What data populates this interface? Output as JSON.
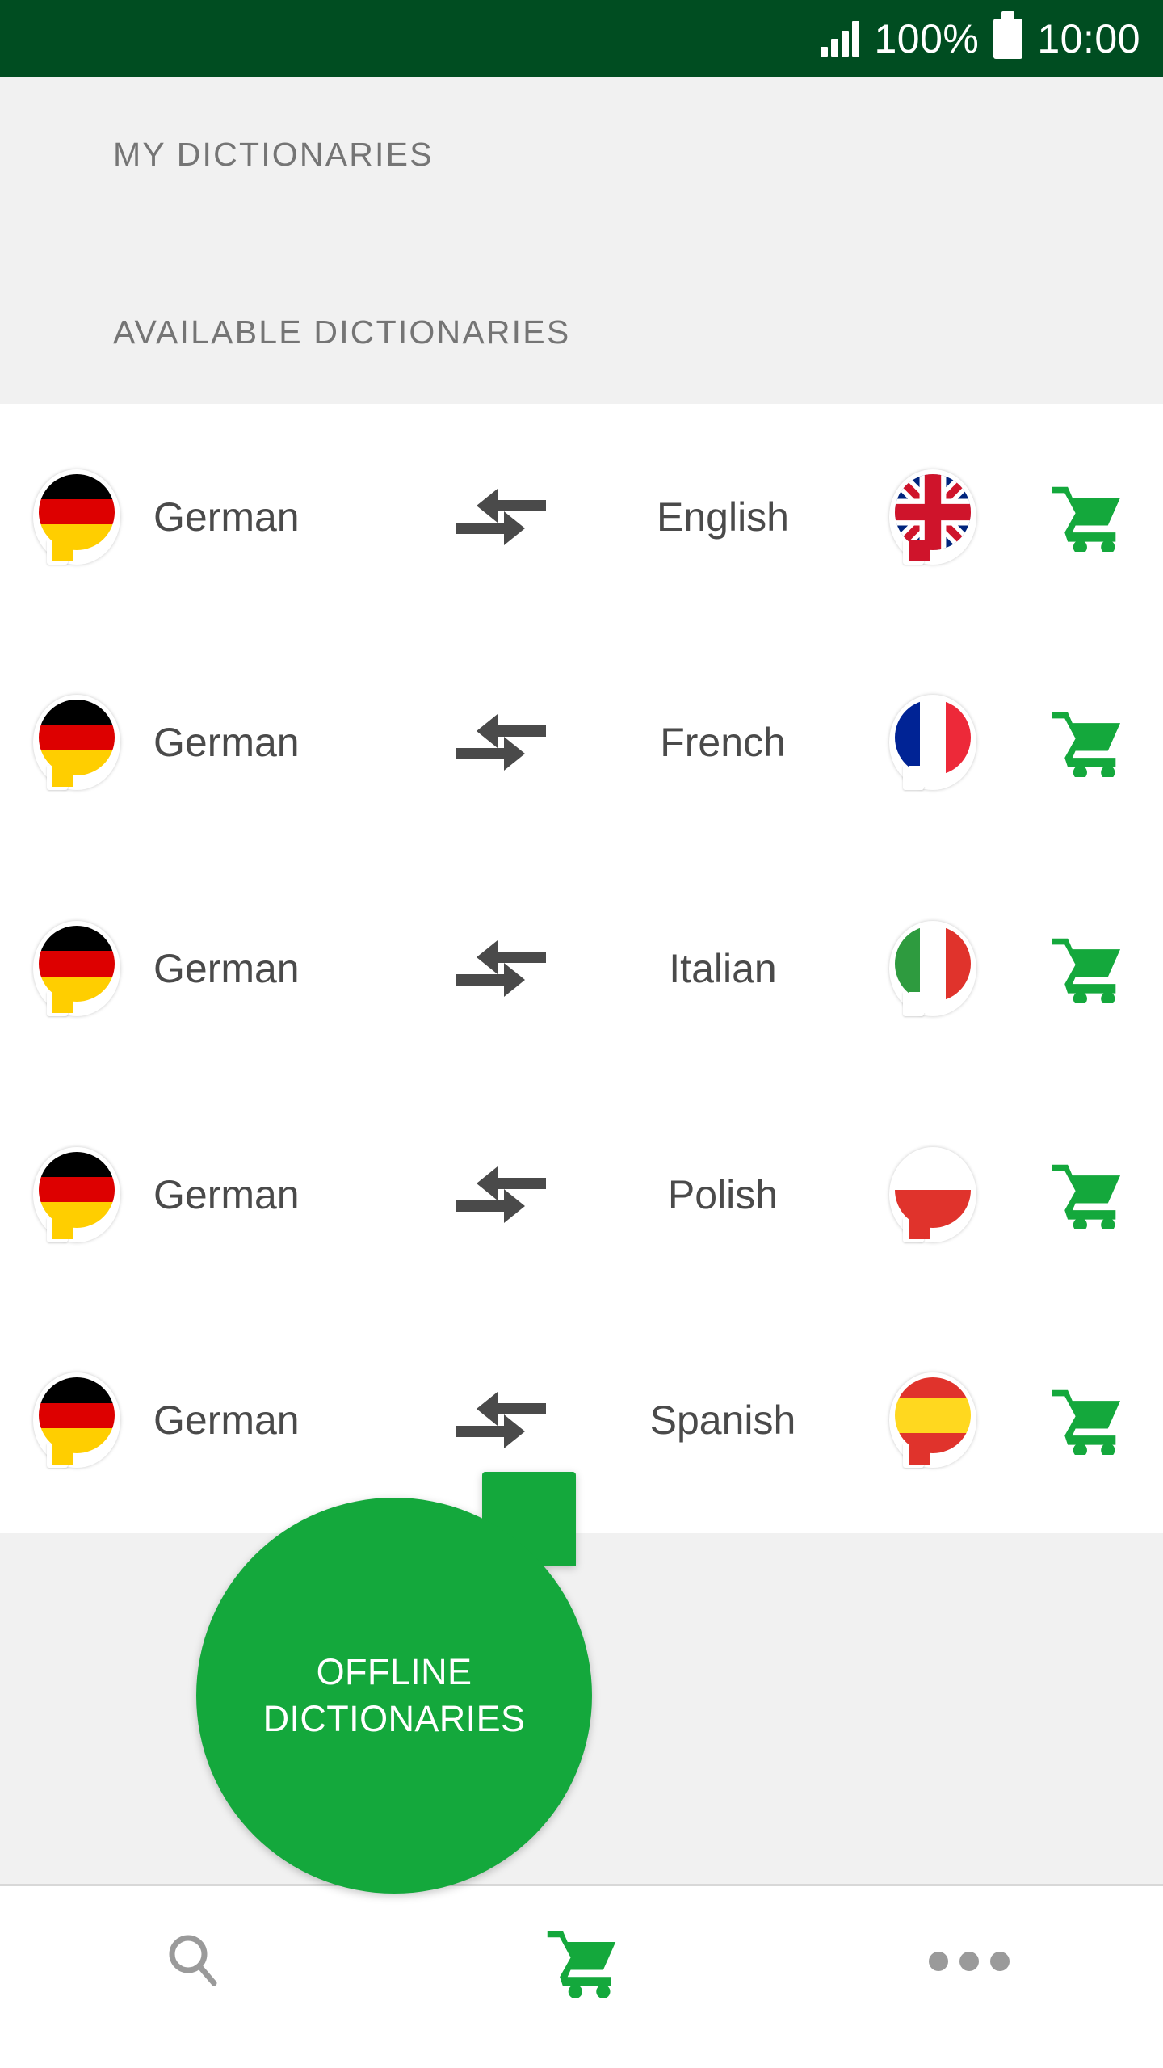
{
  "status_bar": {
    "signal_icon": "signal-bars-icon",
    "battery_percent": "100%",
    "battery_icon": "battery-full-icon",
    "time": "10:00",
    "background_color": "#004D21"
  },
  "sections": {
    "my_dictionaries_label": "MY DICTIONARIES",
    "available_dictionaries_label": "AVAILABLE DICTIONARIES"
  },
  "dictionaries": [
    {
      "source_language": "German",
      "source_flag": "flag-germany-icon",
      "direction_icon": "bidirectional-arrow-icon",
      "target_language": "English",
      "target_flag": "flag-united-kingdom-icon",
      "action_icon": "shopping-cart-icon"
    },
    {
      "source_language": "German",
      "source_flag": "flag-germany-icon",
      "direction_icon": "bidirectional-arrow-icon",
      "target_language": "French",
      "target_flag": "flag-france-icon",
      "action_icon": "shopping-cart-icon"
    },
    {
      "source_language": "German",
      "source_flag": "flag-germany-icon",
      "direction_icon": "bidirectional-arrow-icon",
      "target_language": "Italian",
      "target_flag": "flag-italy-icon",
      "action_icon": "shopping-cart-icon"
    },
    {
      "source_language": "German",
      "source_flag": "flag-germany-icon",
      "direction_icon": "bidirectional-arrow-icon",
      "target_language": "Polish",
      "target_flag": "flag-poland-icon",
      "action_icon": "shopping-cart-icon"
    },
    {
      "source_language": "German",
      "source_flag": "flag-germany-icon",
      "direction_icon": "bidirectional-arrow-icon",
      "target_language": "Spanish",
      "target_flag": "flag-spain-icon",
      "action_icon": "shopping-cart-icon"
    }
  ],
  "offline_overlay": {
    "label": "OFFLINE\nDICTIONARIES",
    "color": "#14A83C"
  },
  "bottom_nav": {
    "items": [
      {
        "icon": "search-icon",
        "color": "#9A9A9A"
      },
      {
        "icon": "shopping-cart-icon",
        "color": "#14A83C"
      },
      {
        "icon": "more-options-icon",
        "color": "#9A9A9A"
      }
    ]
  },
  "colors": {
    "status_bar_green": "#004D21",
    "accent_green": "#14A83C",
    "section_gray_bg": "#F1F1F1",
    "label_gray": "#757575",
    "text_dark": "#4A4A4A"
  }
}
